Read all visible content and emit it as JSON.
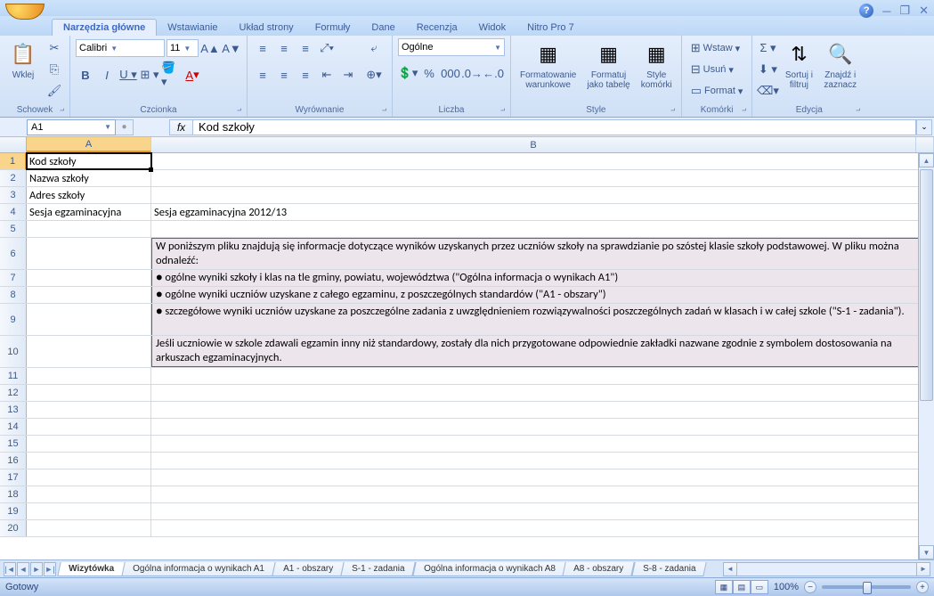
{
  "tabs": {
    "home": "Narzędzia główne",
    "insert": "Wstawianie",
    "layout": "Układ strony",
    "formulas": "Formuły",
    "data": "Dane",
    "review": "Recenzja",
    "view": "Widok",
    "nitro": "Nitro Pro 7"
  },
  "ribbon": {
    "clipboard": {
      "title": "Schowek",
      "paste": "Wklej"
    },
    "font": {
      "title": "Czcionka",
      "name": "Calibri",
      "size": "11"
    },
    "align": {
      "title": "Wyrównanie"
    },
    "number": {
      "title": "Liczba",
      "format": "Ogólne"
    },
    "styles": {
      "title": "Style",
      "cond": "Formatowanie\nwarunkowe",
      "table": "Formatuj\njako tabelę",
      "cell": "Style\nkomórki"
    },
    "cells": {
      "title": "Komórki",
      "insert": "Wstaw",
      "delete": "Usuń",
      "format": "Format"
    },
    "editing": {
      "title": "Edycja",
      "sort": "Sortuj i\nfiltruj",
      "find": "Znajdź i\nzaznacz"
    }
  },
  "namebox": "A1",
  "formula": "Kod szkoły",
  "cells": {
    "A1": "Kod szkoły",
    "A2": "Nazwa szkoły",
    "A3": "Adres szkoły",
    "A4": "Sesja egzaminacyjna",
    "B4": "Sesja egzaminacyjna 2012/13",
    "B6": "W poniższym pliku znajdują się informacje dotyczące wyników uzyskanych przez uczniów szkoły na sprawdzianie po szóstej klasie szkoły podstawowej. W pliku można odnaleźć:",
    "B7": "  ●  ogólne wyniki szkoły i klas na tle gminy, powiatu, województwa (\"Ogólna informacja o wynikach A1\")",
    "B8": "  ●  ogólne wyniki uczniów uzyskane z całego egzaminu, z poszczególnych standardów (\"A1 - obszary\")",
    "B9": "  ●  szczegółowe wyniki uczniów uzyskane za poszczególne zadania z uwzględnieniem rozwiązywalności poszczególnych zadań w klasach i w całej szkole (\"S-1 - zadania\").",
    "B10": "Jeśli uczniowie w szkole zdawali egzamin inny niż standardowy, zostały dla nich przygotowane odpowiednie zakładki nazwane zgodnie z symbolem dostosowania na arkuszach egzaminacyjnych."
  },
  "sheets": {
    "s1": "Wizytówka",
    "s2": "Ogólna informacja o wynikach A1",
    "s3": "A1 - obszary",
    "s4": "S-1 - zadania",
    "s5": "Ogólna informacja o wynikach A8",
    "s6": "A8 - obszary",
    "s7": "S-8 - zadania"
  },
  "status": {
    "ready": "Gotowy",
    "zoom": "100%"
  }
}
